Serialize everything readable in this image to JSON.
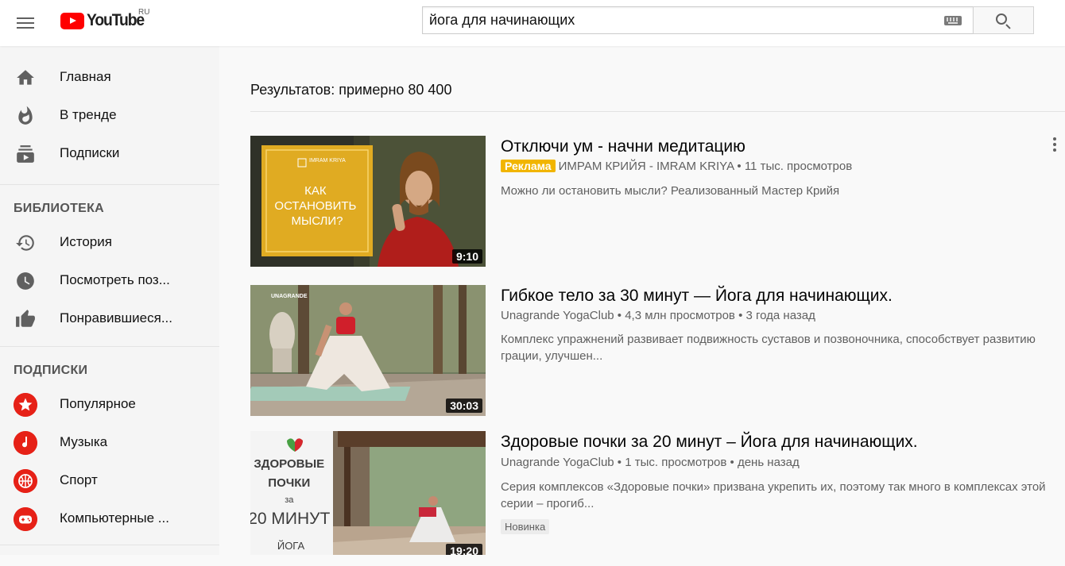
{
  "header": {
    "logo_text": "YouTube",
    "region": "RU",
    "search_value": "йога для начинающих"
  },
  "sidebar": {
    "main_items": [
      {
        "label": "Главная",
        "icon": "home-icon"
      },
      {
        "label": "В тренде",
        "icon": "flame-icon"
      },
      {
        "label": "Подписки",
        "icon": "subscriptions-icon"
      }
    ],
    "library_title": "БИБЛИОТЕКА",
    "library_items": [
      {
        "label": "История",
        "icon": "history-icon"
      },
      {
        "label": "Посмотреть поз...",
        "icon": "clock-icon"
      },
      {
        "label": "Понравившиеся...",
        "icon": "thumbs-up-icon"
      }
    ],
    "subscriptions_title": "ПОДПИСКИ",
    "subscription_items": [
      {
        "label": "Популярное",
        "icon": "star-icon"
      },
      {
        "label": "Музыка",
        "icon": "music-note-icon"
      },
      {
        "label": "Спорт",
        "icon": "basketball-icon"
      },
      {
        "label": "Компьютерные ...",
        "icon": "gamepad-icon"
      }
    ]
  },
  "results": {
    "count_text": "Результатов: примерно 80 400",
    "videos": [
      {
        "title": "Отключи ум - начни медитацию",
        "ad_label": "Реклама",
        "meta": "ИМРАМ КРИЙЯ - IMRAM KRIYA • 11 тыс. просмотров",
        "description": "Можно ли остановить мысли? Реализованный Мастер Крийя",
        "duration": "9:10",
        "thumb_text": "КАК ОСТАНОВИТЬ МЫСЛИ?",
        "thumb_brand": "IMRAM KRIYA"
      },
      {
        "title": "Гибкое тело за 30 минут — Йога для начинающих.",
        "meta": "Unagrande YogaClub • 4,3 млн просмотров • 3 года назад",
        "description": "Комплекс упражнений развивает подвижность суставов и позвоночника, способствует развитию грации, улучшен...",
        "duration": "30:03",
        "thumb_brand": "UNAGRANDE"
      },
      {
        "title": "Здоровые почки за 20 минут – Йога для начинающих.",
        "meta": "Unagrande YogaClub • 1 тыс. просмотров • день назад",
        "description": "Серия комплексов «Здоровые почки» призвана укрепить их, поэтому так много в комплексах этой серии – прогиб...",
        "badge": "Новинка",
        "duration": "19:20",
        "thumb_line1": "ЗДОРОВЫЕ",
        "thumb_line2": "ПОЧКИ",
        "thumb_line3": "за",
        "thumb_line4": "20 МИНУТ",
        "thumb_line5": "ЙОГА"
      }
    ]
  },
  "colors": {
    "brand_red": "#ff0000",
    "ad_yellow": "#f1b500",
    "sidebar_bg": "#f5f5f5",
    "page_bg": "#f9f9f9"
  }
}
